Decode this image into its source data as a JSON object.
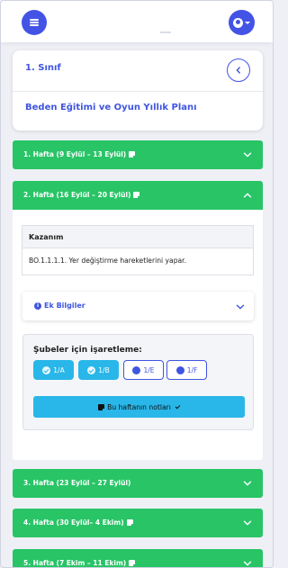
{
  "colors": {
    "primary": "#4353e6",
    "title_blue": "#3f55e0",
    "week_green": "#28c466",
    "chip_cyan": "#29b6e8",
    "background": "#eef0f6"
  },
  "header": {
    "menu_icon": "hamburger-icon",
    "user_icon": "user-circle-icon"
  },
  "title_card": {
    "grade": "1. Sınıf",
    "plan_title": "Beden Eğitimi ve Oyun Yıllık Planı",
    "back_icon": "chevron-left-icon"
  },
  "weeks": [
    {
      "label": "1. Hafta (9 Eylül – 13 Eylül)",
      "has_note": true,
      "expanded": false
    },
    {
      "label": "2. Hafta (16 Eylül – 20 Eylül)",
      "has_note": true,
      "expanded": true
    },
    {
      "label": "3. Hafta (23 Eylül – 27 Eylül)",
      "has_note": false,
      "expanded": false
    },
    {
      "label": "4. Hafta (30 Eylül– 4 Ekim)",
      "has_note": true,
      "expanded": false
    },
    {
      "label": "5. Hafta (7 Ekim – 11 Ekim)",
      "has_note": true,
      "expanded": false
    }
  ],
  "week_detail": {
    "table_header": "Kazanım",
    "kazanim": "BO.1.1.1.1. Yer değiştirme hareketlerini yapar.",
    "ek_bilgiler": "Ek Bilgiler",
    "sube_title": "Şubeler için işaretleme:",
    "subeler": [
      {
        "label": "1/A",
        "checked": true
      },
      {
        "label": "1/B",
        "checked": true
      },
      {
        "label": "1/E",
        "checked": false
      },
      {
        "label": "1/F",
        "checked": false
      }
    ],
    "notes_button": "Bu haftanın notları"
  }
}
